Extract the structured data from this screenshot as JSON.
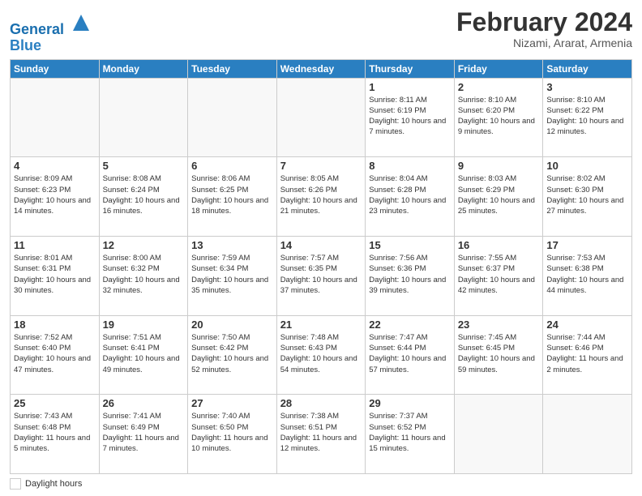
{
  "header": {
    "logo_line1": "General",
    "logo_line2": "Blue",
    "month_title": "February 2024",
    "location": "Nizami, Ararat, Armenia"
  },
  "days_of_week": [
    "Sunday",
    "Monday",
    "Tuesday",
    "Wednesday",
    "Thursday",
    "Friday",
    "Saturday"
  ],
  "weeks": [
    [
      {
        "num": "",
        "info": ""
      },
      {
        "num": "",
        "info": ""
      },
      {
        "num": "",
        "info": ""
      },
      {
        "num": "",
        "info": ""
      },
      {
        "num": "1",
        "info": "Sunrise: 8:11 AM\nSunset: 6:19 PM\nDaylight: 10 hours and 7 minutes."
      },
      {
        "num": "2",
        "info": "Sunrise: 8:10 AM\nSunset: 6:20 PM\nDaylight: 10 hours and 9 minutes."
      },
      {
        "num": "3",
        "info": "Sunrise: 8:10 AM\nSunset: 6:22 PM\nDaylight: 10 hours and 12 minutes."
      }
    ],
    [
      {
        "num": "4",
        "info": "Sunrise: 8:09 AM\nSunset: 6:23 PM\nDaylight: 10 hours and 14 minutes."
      },
      {
        "num": "5",
        "info": "Sunrise: 8:08 AM\nSunset: 6:24 PM\nDaylight: 10 hours and 16 minutes."
      },
      {
        "num": "6",
        "info": "Sunrise: 8:06 AM\nSunset: 6:25 PM\nDaylight: 10 hours and 18 minutes."
      },
      {
        "num": "7",
        "info": "Sunrise: 8:05 AM\nSunset: 6:26 PM\nDaylight: 10 hours and 21 minutes."
      },
      {
        "num": "8",
        "info": "Sunrise: 8:04 AM\nSunset: 6:28 PM\nDaylight: 10 hours and 23 minutes."
      },
      {
        "num": "9",
        "info": "Sunrise: 8:03 AM\nSunset: 6:29 PM\nDaylight: 10 hours and 25 minutes."
      },
      {
        "num": "10",
        "info": "Sunrise: 8:02 AM\nSunset: 6:30 PM\nDaylight: 10 hours and 27 minutes."
      }
    ],
    [
      {
        "num": "11",
        "info": "Sunrise: 8:01 AM\nSunset: 6:31 PM\nDaylight: 10 hours and 30 minutes."
      },
      {
        "num": "12",
        "info": "Sunrise: 8:00 AM\nSunset: 6:32 PM\nDaylight: 10 hours and 32 minutes."
      },
      {
        "num": "13",
        "info": "Sunrise: 7:59 AM\nSunset: 6:34 PM\nDaylight: 10 hours and 35 minutes."
      },
      {
        "num": "14",
        "info": "Sunrise: 7:57 AM\nSunset: 6:35 PM\nDaylight: 10 hours and 37 minutes."
      },
      {
        "num": "15",
        "info": "Sunrise: 7:56 AM\nSunset: 6:36 PM\nDaylight: 10 hours and 39 minutes."
      },
      {
        "num": "16",
        "info": "Sunrise: 7:55 AM\nSunset: 6:37 PM\nDaylight: 10 hours and 42 minutes."
      },
      {
        "num": "17",
        "info": "Sunrise: 7:53 AM\nSunset: 6:38 PM\nDaylight: 10 hours and 44 minutes."
      }
    ],
    [
      {
        "num": "18",
        "info": "Sunrise: 7:52 AM\nSunset: 6:40 PM\nDaylight: 10 hours and 47 minutes."
      },
      {
        "num": "19",
        "info": "Sunrise: 7:51 AM\nSunset: 6:41 PM\nDaylight: 10 hours and 49 minutes."
      },
      {
        "num": "20",
        "info": "Sunrise: 7:50 AM\nSunset: 6:42 PM\nDaylight: 10 hours and 52 minutes."
      },
      {
        "num": "21",
        "info": "Sunrise: 7:48 AM\nSunset: 6:43 PM\nDaylight: 10 hours and 54 minutes."
      },
      {
        "num": "22",
        "info": "Sunrise: 7:47 AM\nSunset: 6:44 PM\nDaylight: 10 hours and 57 minutes."
      },
      {
        "num": "23",
        "info": "Sunrise: 7:45 AM\nSunset: 6:45 PM\nDaylight: 10 hours and 59 minutes."
      },
      {
        "num": "24",
        "info": "Sunrise: 7:44 AM\nSunset: 6:46 PM\nDaylight: 11 hours and 2 minutes."
      }
    ],
    [
      {
        "num": "25",
        "info": "Sunrise: 7:43 AM\nSunset: 6:48 PM\nDaylight: 11 hours and 5 minutes."
      },
      {
        "num": "26",
        "info": "Sunrise: 7:41 AM\nSunset: 6:49 PM\nDaylight: 11 hours and 7 minutes."
      },
      {
        "num": "27",
        "info": "Sunrise: 7:40 AM\nSunset: 6:50 PM\nDaylight: 11 hours and 10 minutes."
      },
      {
        "num": "28",
        "info": "Sunrise: 7:38 AM\nSunset: 6:51 PM\nDaylight: 11 hours and 12 minutes."
      },
      {
        "num": "29",
        "info": "Sunrise: 7:37 AM\nSunset: 6:52 PM\nDaylight: 11 hours and 15 minutes."
      },
      {
        "num": "",
        "info": ""
      },
      {
        "num": "",
        "info": ""
      }
    ]
  ],
  "footer": {
    "label": "Daylight hours"
  }
}
